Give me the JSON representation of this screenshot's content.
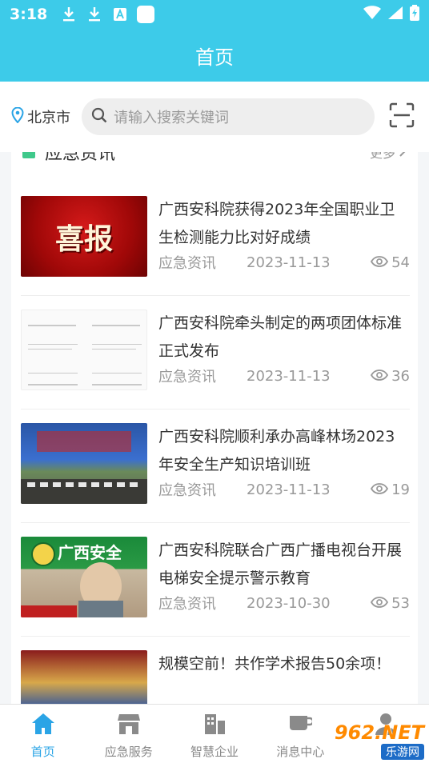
{
  "status_bar": {
    "time": "3:18"
  },
  "header": {
    "title": "首页"
  },
  "search": {
    "city": "北京市",
    "placeholder": "请输入搜索关键词"
  },
  "section": {
    "title": "应急资讯",
    "more": "更多"
  },
  "news": [
    {
      "title": "广西安科院获得2023年全国职业卫生检测能力比对好成绩",
      "category": "应急资讯",
      "date": "2023-11-13",
      "views": "54",
      "thumb_text": "喜报"
    },
    {
      "title": "广西安科院牵头制定的两项团体标准正式发布",
      "category": "应急资讯",
      "date": "2023-11-13",
      "views": "36"
    },
    {
      "title": "广西安科院顺利承办高峰林场2023年安全生产知识培训班",
      "category": "应急资讯",
      "date": "2023-11-13",
      "views": "19"
    },
    {
      "title": "广西安科院联合广西广播电视台开展电梯安全提示警示教育",
      "category": "应急资讯",
      "date": "2023-10-30",
      "views": "53",
      "thumb_text": "广西安全"
    },
    {
      "title": "规模空前！共作学术报告50余项！",
      "category": "",
      "date": "",
      "views": ""
    }
  ],
  "tabs": [
    {
      "label": "首页",
      "icon": "home-icon",
      "active": true
    },
    {
      "label": "应急服务",
      "icon": "store-icon"
    },
    {
      "label": "智慧企业",
      "icon": "building-icon"
    },
    {
      "label": "消息中心",
      "icon": "message-icon"
    },
    {
      "label": "",
      "icon": "user-icon"
    }
  ],
  "watermark": {
    "top": "962.NET",
    "bottom": "乐游网"
  },
  "colors": {
    "primary": "#3dcbe9",
    "tab_active": "#2aa4e6",
    "section_accent": "#3fc98b"
  }
}
